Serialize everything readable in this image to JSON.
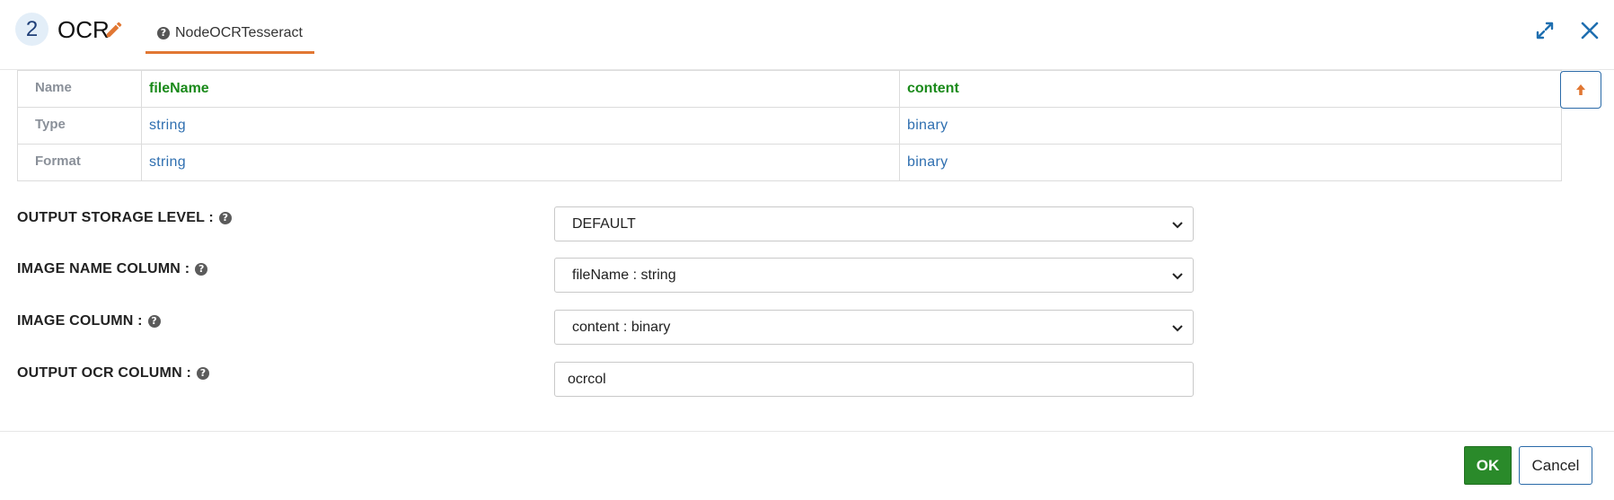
{
  "header": {
    "step_number": "2",
    "title": "OCR",
    "tab_label": "NodeOCRTesseract"
  },
  "schema_table": {
    "row_headers": [
      "Name",
      "Type",
      "Format"
    ],
    "columns": [
      {
        "name": "fileName",
        "type": "string",
        "format": "string"
      },
      {
        "name": "content",
        "type": "binary",
        "format": "binary"
      }
    ]
  },
  "form": {
    "output_storage_level": {
      "label": "OUTPUT STORAGE LEVEL :",
      "value": "DEFAULT"
    },
    "image_name_column": {
      "label": "IMAGE NAME COLUMN :",
      "value": "fileName : string"
    },
    "image_column": {
      "label": "IMAGE COLUMN :",
      "value": "content : binary"
    },
    "output_ocr_column": {
      "label": "OUTPUT OCR COLUMN :",
      "value": "ocrcol"
    }
  },
  "footer": {
    "ok_label": "OK",
    "cancel_label": "Cancel"
  },
  "icons": {
    "edit": "pencil-icon",
    "help": "question-circle-icon",
    "expand": "expand-icon",
    "close": "close-icon",
    "scroll_top": "arrow-up-icon",
    "dropdown": "chevron-down-icon"
  },
  "colors": {
    "accent_orange": "#e17733",
    "field_name_green": "#1a8a1a",
    "type_blue": "#2f6fb0",
    "ok_green": "#2a8a2a",
    "brand_blue": "#2a6aa8",
    "badge_bg": "#e3eef8"
  }
}
